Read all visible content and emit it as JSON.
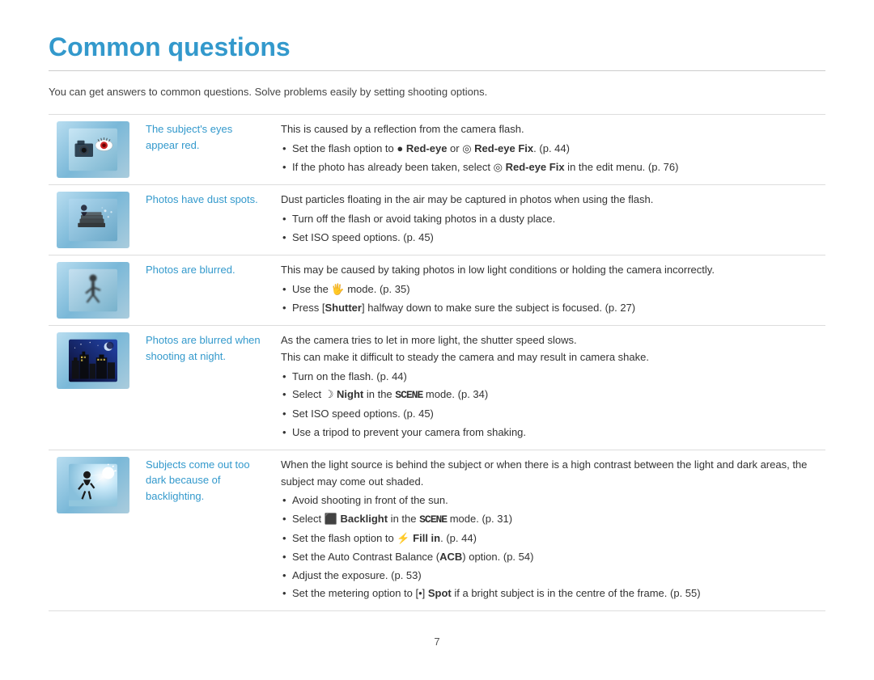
{
  "page": {
    "title": "Common questions",
    "subtitle": "You can get answers to common questions. Solve problems easily by setting shooting options.",
    "page_number": "7"
  },
  "rows": [
    {
      "id": "row-red-eye",
      "label": "The subject's eyes appear red.",
      "content_intro": "This is caused by a reflection from the camera flash.",
      "bullets": [
        "Set the flash option to ● Red-eye or ◎ Red-eye Fix. (p. 44)",
        "If the photo has already been taken, select ◎ Red-eye Fix in the edit menu. (p. 76)"
      ],
      "has_bullets": true,
      "img_type": "eye"
    },
    {
      "id": "row-dust",
      "label": "Photos have dust spots.",
      "content_intro": "Dust particles floating in the air may be captured in photos when using the flash.",
      "bullets": [
        "Turn off the flash or avoid taking photos in a dusty place.",
        "Set ISO speed options. (p. 45)"
      ],
      "has_bullets": true,
      "img_type": "stack"
    },
    {
      "id": "row-blurred",
      "label": "Photos are blurred.",
      "content_intro": "This may be caused by taking photos in low light conditions or holding the camera incorrectly.",
      "bullets": [
        "Use the 🖐 mode. (p. 35)",
        "Press [Shutter] halfway down to make sure the subject is focused. (p. 27)"
      ],
      "has_bullets": true,
      "img_type": "person-blur"
    },
    {
      "id": "row-blurred-night",
      "label": "Photos are blurred when shooting at night.",
      "content_intro": "As the camera tries to let in more light, the shutter speed slows.",
      "content_extra": "This can make it difficult to steady the camera and may result in camera shake.",
      "bullets": [
        "Turn on the flash. (p. 44)",
        "Select ☽ Night in the SCENE mode. (p. 34)",
        "Set ISO speed options. (p. 45)",
        "Use a tripod to prevent your camera from shaking."
      ],
      "has_bullets": true,
      "img_type": "night"
    },
    {
      "id": "row-backlight",
      "label": "Subjects come out too dark because of backlighting.",
      "content_intro": "When the light source is behind the subject or when there is a high contrast between the light and dark areas, the subject may come out shaded.",
      "bullets": [
        "Avoid shooting in front of the sun.",
        "Select ⬛ Backlight in the SCENE mode. (p. 31)",
        "Set the flash option to ⚡ Fill in. (p. 44)",
        "Set the Auto Contrast Balance (ACB) option. (p. 54)",
        "Adjust the exposure. (p. 53)",
        "Set the metering option to [•] Spot if a bright subject is in the centre of the frame. (p. 55)"
      ],
      "has_bullets": true,
      "img_type": "backlight"
    }
  ]
}
